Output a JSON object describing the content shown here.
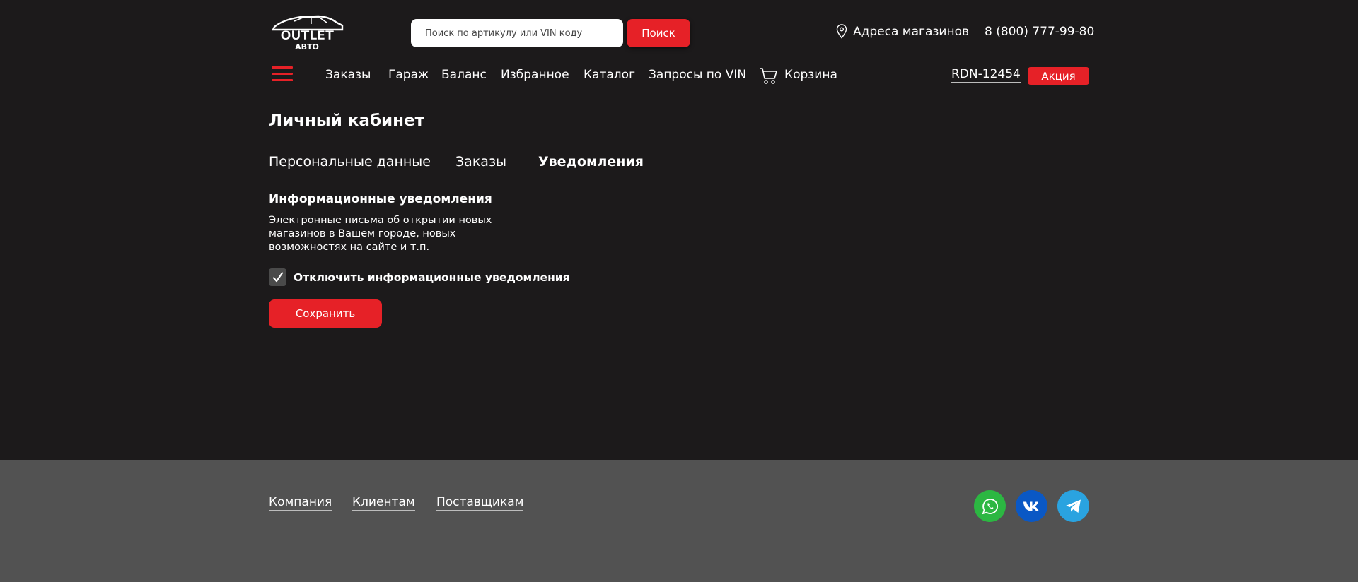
{
  "header": {
    "logo_text": "OUTLET",
    "logo_subtext": "АВТО",
    "search_placeholder": "Поиск по артикулу или VIN коду",
    "search_button": "Поиск",
    "stores_label": "Адреса магазинов",
    "phone": "8 (800) 777-99-80"
  },
  "nav": {
    "items": [
      {
        "label": "Заказы"
      },
      {
        "label": "Гараж"
      },
      {
        "label": "Баланс"
      },
      {
        "label": "Избранное"
      },
      {
        "label": "Каталог"
      },
      {
        "label": "Запросы по VIN"
      },
      {
        "label": "Корзина"
      }
    ],
    "account_id": "RDN-12454",
    "promo_button": "Акция"
  },
  "page": {
    "title": "Личный кабинет",
    "tabs": [
      {
        "label": "Персональные данные",
        "active": false
      },
      {
        "label": "Заказы",
        "active": false
      },
      {
        "label": "Уведомления",
        "active": true
      }
    ],
    "section_title": "Информационные уведомления",
    "description": "Электронные письма об открытии новых магазинов в Вашем городе, новых возможностях на сайте и т.п.",
    "checkbox_label": "Отключить информационные уведомления",
    "checkbox_checked": true,
    "save_button": "Сохранить"
  },
  "footer": {
    "links": [
      {
        "label": "Компания"
      },
      {
        "label": "Клиентам"
      },
      {
        "label": "Поставщикам"
      }
    ],
    "social": [
      {
        "name": "whatsapp-icon",
        "color": "#2cb742"
      },
      {
        "name": "vk-icon",
        "color": "#0a58c5"
      },
      {
        "name": "telegram-icon",
        "color": "#2aa3e0"
      }
    ]
  },
  "colors": {
    "background": "#1c1a1b",
    "footer_background": "#525252",
    "accent": "#e62127"
  }
}
